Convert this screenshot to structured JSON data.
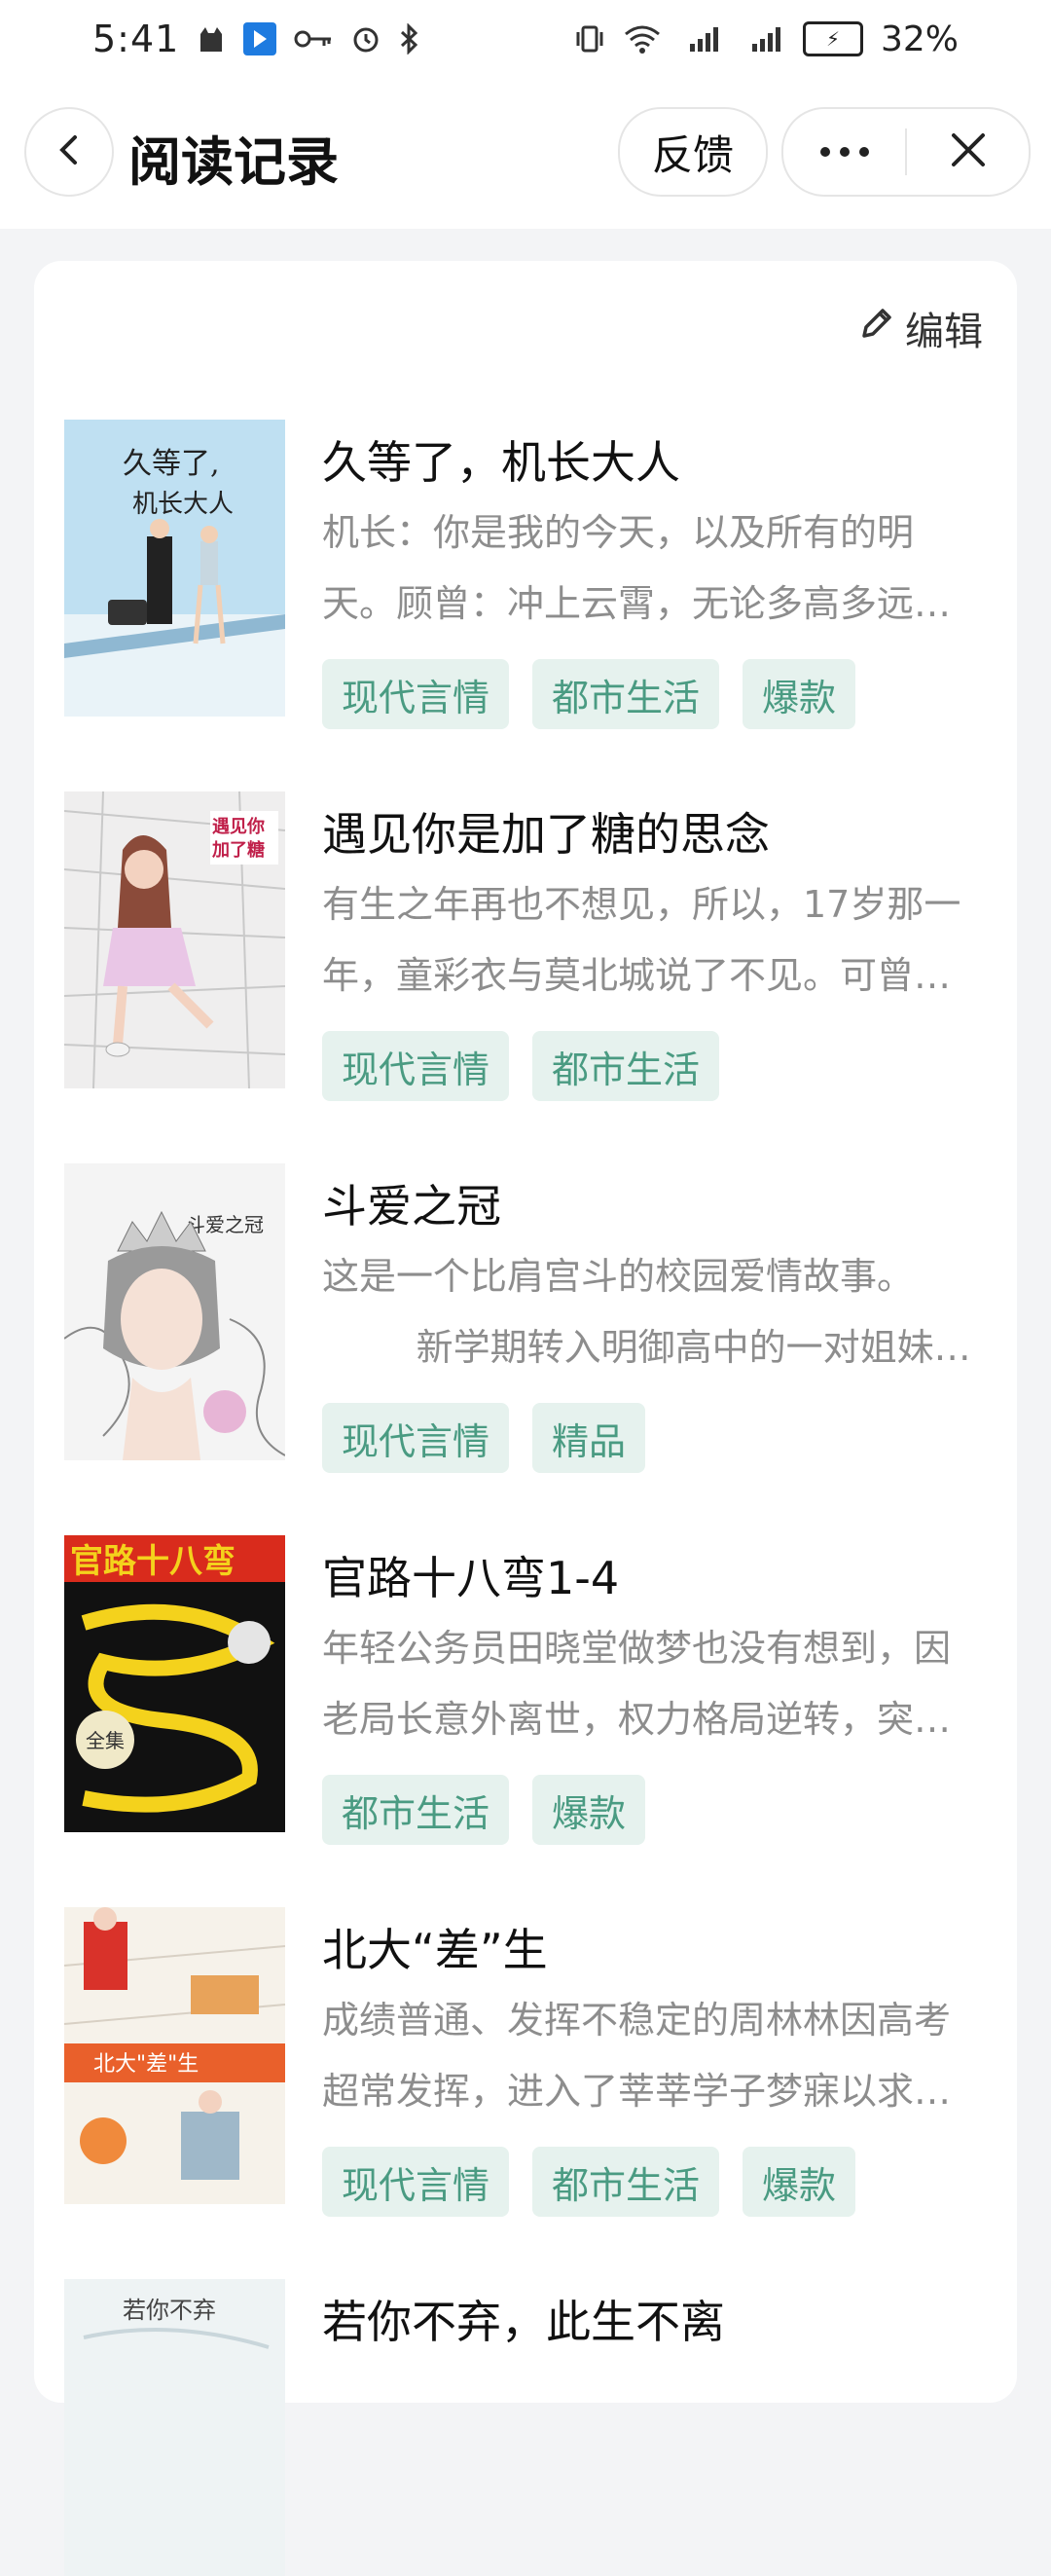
{
  "status": {
    "time": "5:41",
    "battery": "32%",
    "left_icons": [
      "cat-icon",
      "direction-icon",
      "key-icon",
      "alarm-icon",
      "bluetooth-icon"
    ],
    "right_icons": [
      "vibrate-icon",
      "wifi-icon",
      "signal-4g-icon",
      "signal-4g-icon-2",
      "battery-icon"
    ]
  },
  "header": {
    "title": "阅读记录",
    "feedback_label": "反馈"
  },
  "list": {
    "edit_label": "编辑"
  },
  "books": [
    {
      "title": "久等了，机长大人",
      "desc": "机长：你是我的今天，以及所有的明天。顾曾：冲上云霄，无论多高多远，我都在你身边。",
      "tags": [
        "现代言情",
        "都市生活",
        "爆款"
      ]
    },
    {
      "title": "遇见你是加了糖的思念",
      "desc": "有生之年再也不想见，所以，17岁那一年，童彩衣与莫北城说了不见。可曾想过再见时会是怎样。",
      "tags": [
        "现代言情",
        "都市生活"
      ]
    },
    {
      "title": "斗爱之冠",
      "desc": "这是一个比肩宫斗的校园爱情故事。\n        新学期转入明御高中的一对姐妹花，从此掀起了波澜。",
      "tags": [
        "现代言情",
        "精品"
      ]
    },
    {
      "title": "官路十八弯1-4",
      "desc": "年轻公务员田晓堂做梦也没有想到，因老局长意外离世，权力格局逆转，突然之间他的命运发生了变化。",
      "tags": [
        "都市生活",
        "爆款"
      ]
    },
    {
      "title": "北大“差”生",
      "desc": "成绩普通、发挥不稳定的周林林因高考超常发挥，进入了莘莘学子梦寐以求的北大，从此开始了新的生活。",
      "tags": [
        "现代言情",
        "都市生活",
        "爆款"
      ]
    },
    {
      "title": "若你不弃，此生不离",
      "desc": "",
      "tags": []
    }
  ]
}
